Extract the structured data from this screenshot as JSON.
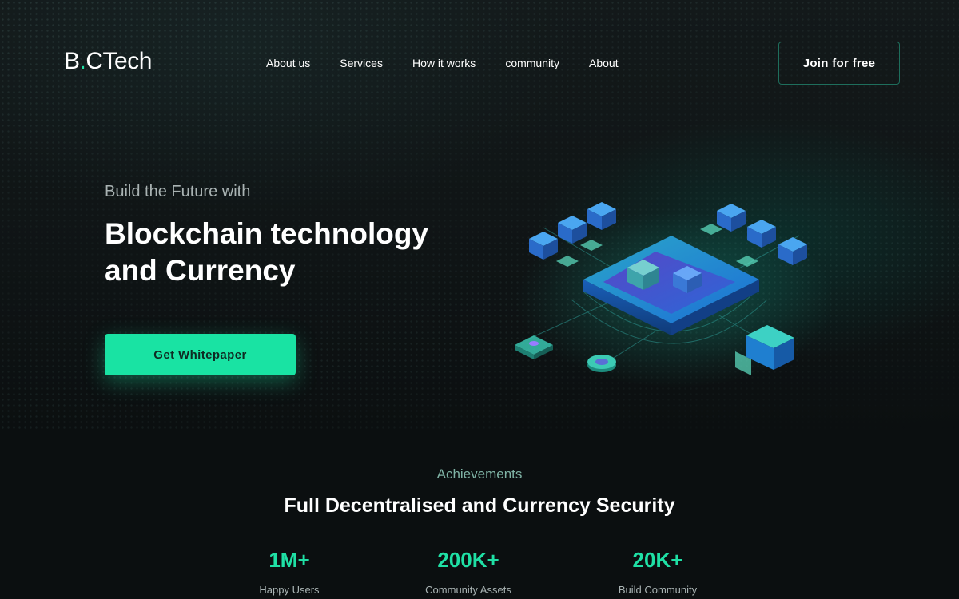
{
  "brand": {
    "name_prefix": "B",
    "name_dot": ".",
    "name_suffix": "CTech",
    "accent": "#1fe0a5"
  },
  "nav": {
    "items": [
      {
        "label": "About us"
      },
      {
        "label": "Services"
      },
      {
        "label": "How it works"
      },
      {
        "label": "community"
      },
      {
        "label": "About"
      }
    ],
    "join_label": "Join for free"
  },
  "hero": {
    "subtitle": "Build the Future with",
    "title_line1": "Blockchain technology",
    "title_line2": "and Currency",
    "cta_label": "Get Whitepaper",
    "illustration_icon": "isometric-blockchain-illustration"
  },
  "achievements": {
    "label": "Achievements",
    "title": "Full Decentralised and Currency Security",
    "stats": [
      {
        "value": "1M+",
        "label": "Happy Users"
      },
      {
        "value": "200K+",
        "label": "Community Assets"
      },
      {
        "value": "20K+",
        "label": "Build Community"
      }
    ]
  },
  "colors": {
    "background": "#0b0f10",
    "accent": "#19e3a3",
    "muted_text": "#a9b3b3"
  }
}
